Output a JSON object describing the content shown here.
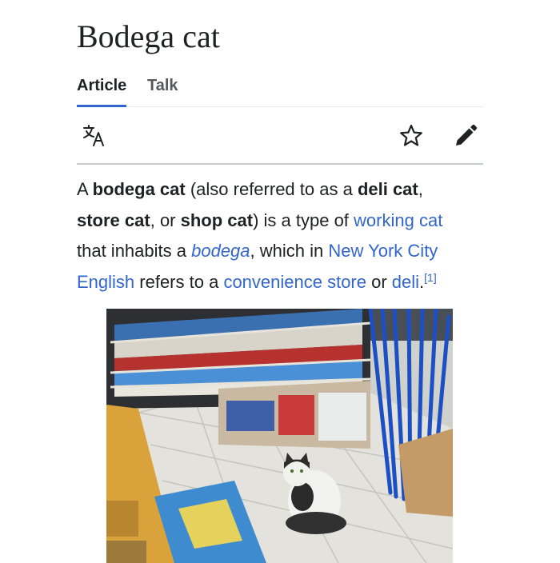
{
  "article": {
    "title": "Bodega cat",
    "tabs": [
      {
        "label": "Article",
        "active": true
      },
      {
        "label": "Talk",
        "active": false
      }
    ],
    "toolbar": {
      "language_icon": "translate-icon",
      "watch_icon": "star-icon",
      "edit_icon": "pencil-icon"
    }
  },
  "content": {
    "p1": "A ",
    "b1": "bodega cat",
    "p2": " (also referred to as a ",
    "b2": "deli cat",
    "p3": ",",
    "b3": "store cat",
    "p4": ", or ",
    "b4": "shop cat",
    "p5": ") is a type of ",
    "link_working_cat": "working cat",
    "p6": "that inhabits a ",
    "link_bodega": "bodega",
    "p7": ", which in ",
    "link_nyc": "New York City",
    "link_english": "English",
    "p8": " refers to a ",
    "link_convenience": "convenience store",
    "p9": " or ",
    "link_deli": "deli",
    "p10": ".",
    "ref": "[1]"
  },
  "image": {
    "subject": "cat sitting in a convenience store aisle"
  },
  "colors": {
    "link": "#3366cc",
    "text": "#202122",
    "tab_underline": "#3366cc"
  }
}
